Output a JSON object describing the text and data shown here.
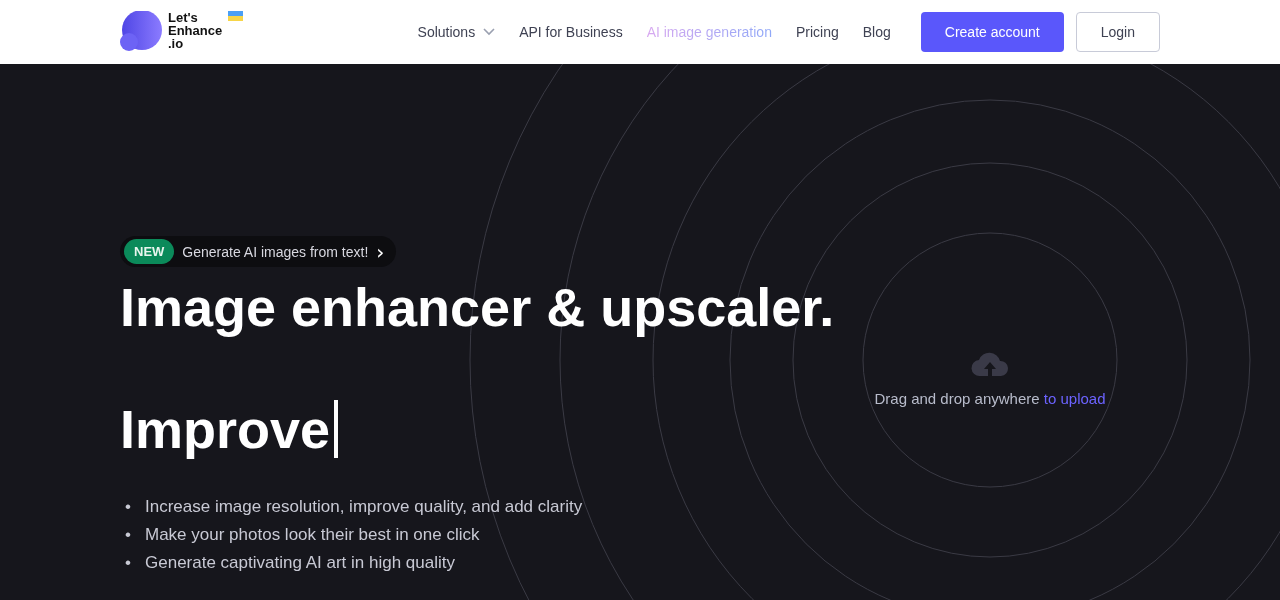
{
  "logo": {
    "lines": [
      "Let's",
      "Enhance",
      ".io"
    ]
  },
  "nav": [
    {
      "label": "Solutions",
      "dropdown": true,
      "highlighted": false
    },
    {
      "label": "API for Business",
      "dropdown": false,
      "highlighted": false
    },
    {
      "label": "AI image generation",
      "dropdown": false,
      "highlighted": true
    },
    {
      "label": "Pricing",
      "dropdown": false,
      "highlighted": false
    },
    {
      "label": "Blog",
      "dropdown": false,
      "highlighted": false
    }
  ],
  "buttons": [
    {
      "label": "Create account",
      "kind": "primary"
    },
    {
      "label": "Login",
      "kind": "outline"
    }
  ],
  "announcement": {
    "badge": "NEW",
    "text": "Generate AI images from text!",
    "arrow": "›"
  },
  "headline": "Image enhancer & upscaler.",
  "typed_word": "Improve",
  "bullets": [
    {
      "marker": "•",
      "text": "Increase image resolution, improve quality, and add clarity"
    },
    {
      "marker": "•",
      "text": "Make your photos look their best in one click"
    },
    {
      "marker": "•",
      "text": "Generate captivating AI art in high quality"
    }
  ],
  "upload": {
    "text": "Drag and drop anywhere",
    "link": "to upload"
  }
}
